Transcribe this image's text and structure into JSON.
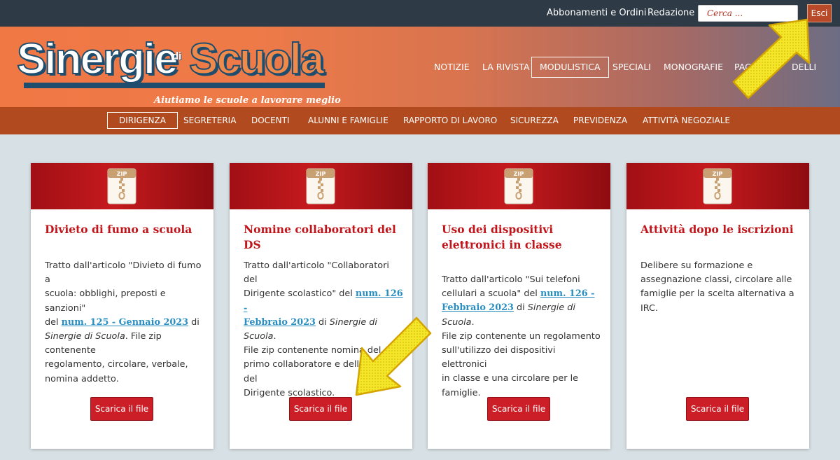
{
  "topbar": {
    "links": [
      "Abbonamenti e Ordini",
      "Redazione"
    ],
    "search_placeholder": "Cerca ...",
    "logout_label": "Esci"
  },
  "header": {
    "logo_main": "Sinergie",
    "logo_di": "di",
    "logo_second": "Scuola",
    "tagline": "Aiutiamo le scuole a lavorare meglio",
    "nav": [
      "NOTIZIE",
      "LA RIVISTA",
      "MODULISTICA",
      "SPECIALI",
      "MONOGRAFIE",
      "PAC",
      "DELLI"
    ],
    "active_nav": "MODULISTICA"
  },
  "subnav": {
    "items": [
      "DIRIGENZA",
      "SEGRETERIA",
      "DOCENTI",
      "ALUNNI E FAMIGLIE",
      "RAPPORTO DI LAVORO",
      "SICUREZZA",
      "PREVIDENZA",
      "ATTIVITÀ NEGOZIALE"
    ],
    "active": "DIRIGENZA"
  },
  "cards": [
    {
      "icon_label": "ZIP",
      "title": "Divieto di fumo a scuola",
      "text_lines": [
        [
          {
            "t": "Tratto dall'articolo \"Divieto di fumo a"
          }
        ],
        [
          {
            "t": "scuola: obblighi, preposti e sanzioni\""
          }
        ],
        [
          {
            "t": "del "
          },
          {
            "t": "num. 125 - Gennaio 2023",
            "link": true
          },
          {
            "t": " di"
          }
        ],
        [
          {
            "t": "Sinergie di Scuola",
            "em": true
          },
          {
            "t": ". File zip contenente"
          }
        ],
        [
          {
            "t": "regolamento, circolare, verbale,"
          }
        ],
        [
          {
            "t": "nomina addetto."
          }
        ]
      ],
      "button": "Scarica il file"
    },
    {
      "icon_label": "ZIP",
      "title": "Nomine collaboratori del DS",
      "text_lines": [
        [
          {
            "t": "Tratto dall'articolo \"Collaboratori del"
          }
        ],
        [
          {
            "t": "Dirigente scolastico\" del "
          },
          {
            "t": "num. 126 -",
            "link": true
          }
        ],
        [
          {
            "t": "Febbraio 2023",
            "link": true
          },
          {
            "t": " di "
          },
          {
            "t": "Sinergie di Scuola",
            "em": true
          },
          {
            "t": "."
          }
        ],
        [
          {
            "t": "File zip contenente nomina del"
          }
        ],
        [
          {
            "t": "primo collaboratore e dello staff del"
          }
        ],
        [
          {
            "t": "Dirigente scolastico."
          }
        ]
      ],
      "button": "Scarica il file"
    },
    {
      "icon_label": "ZIP",
      "title": "Uso dei dispositivi elettronici in classe",
      "text_lines": [
        [
          {
            "t": "Tratto dall'articolo \"Sui telefoni"
          }
        ],
        [
          {
            "t": "cellulari a scuola\" del "
          },
          {
            "t": "num. 126 -",
            "link": true
          }
        ],
        [
          {
            "t": "Febbraio 2023",
            "link": true
          },
          {
            "t": " di "
          },
          {
            "t": "Sinergie di Scuola",
            "em": true
          },
          {
            "t": "."
          }
        ],
        [
          {
            "t": "File zip contenente un regolamento"
          }
        ],
        [
          {
            "t": "sull'utilizzo dei dispositivi elettronici"
          }
        ],
        [
          {
            "t": "in classe e una circolare per le"
          }
        ],
        [
          {
            "t": "famiglie."
          }
        ]
      ],
      "button": "Scarica il file"
    },
    {
      "icon_label": "ZIP",
      "title": "Attività dopo le iscrizioni",
      "text_lines": [
        [
          {
            "t": "Delibere su formazione e"
          }
        ],
        [
          {
            "t": "assegnazione classi, circolare alle"
          }
        ],
        [
          {
            "t": "famiglie per la scelta alternativa a"
          }
        ],
        [
          {
            "t": "IRC."
          }
        ]
      ],
      "button": "Scarica il file"
    }
  ],
  "colors": {
    "topbar": "#2e3a45",
    "subnav": "#b14a1e",
    "card_title": "#c2151b",
    "button": "#cc1e26",
    "link": "#2a8ec0",
    "arrow": "#f6e62a"
  }
}
